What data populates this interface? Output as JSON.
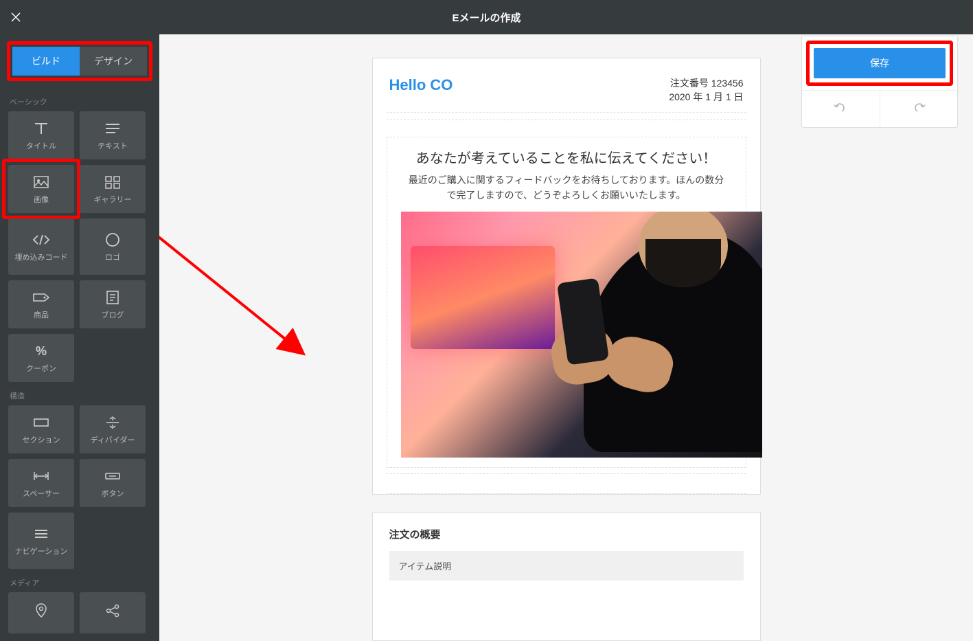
{
  "header": {
    "title": "Eメールの作成"
  },
  "tabs": {
    "build": "ビルド",
    "design": "デザイン"
  },
  "sections": {
    "basic": "ベーシック",
    "structure": "構造",
    "media": "メディア"
  },
  "blocks": {
    "title": "タイトル",
    "text": "テキスト",
    "image": "画像",
    "gallery": "ギャラリー",
    "embed": "埋め込みコード",
    "logo": "ロゴ",
    "product": "商品",
    "blog": "ブログ",
    "coupon": "クーポン",
    "section": "セクション",
    "divider": "ディバイダー",
    "spacer": "スペーサー",
    "button": "ボタン",
    "navigation": "ナビゲーション"
  },
  "actions": {
    "save": "保存"
  },
  "email": {
    "brand": "Hello CO",
    "order_number": "注文番号 123456",
    "order_date": "2020 年 1 月 1 日",
    "headline": "あなたが考えていることを私に伝えてください！",
    "subtext": "最近のご購入に関するフィードバックをお待ちしております。ほんの数分で完了しますので、どうぞよろしくお願いいたします。",
    "summary_title": "注文の概要",
    "table_header": "アイテム説明"
  }
}
